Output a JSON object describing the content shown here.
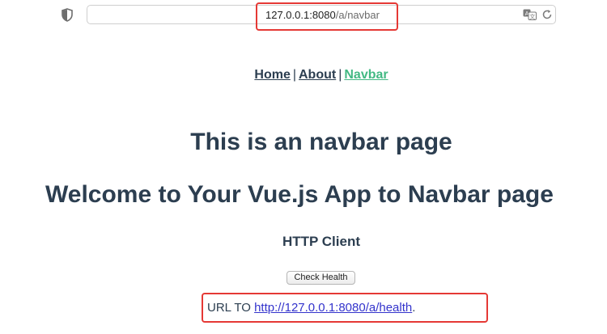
{
  "browser": {
    "url_host": "127.0.0.1:8080",
    "url_path": "/a/navbar"
  },
  "nav": {
    "items": [
      {
        "label": "Home"
      },
      {
        "label": "About"
      },
      {
        "label": "Navbar"
      }
    ],
    "separator": "|",
    "active_color": "#42b983"
  },
  "main": {
    "page_heading": "This is an navbar page",
    "welcome_heading": "Welcome to Your Vue.js App to Navbar page",
    "client_heading": "HTTP Client",
    "check_button_label": "Check Health",
    "url_prefix": "URL TO",
    "health_url": "http://127.0.0.1:8080/a/health",
    "url_suffix": "."
  },
  "colors": {
    "text": "#2c3e50",
    "highlight": "#e53935",
    "link": "#3333cc"
  }
}
